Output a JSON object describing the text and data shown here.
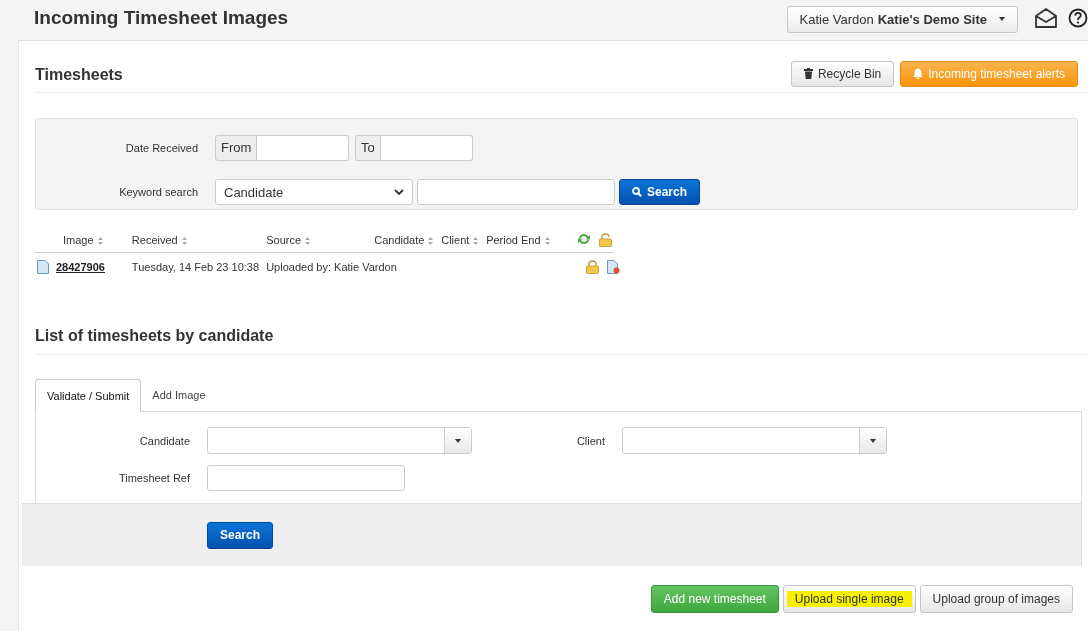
{
  "header": {
    "title": "Incoming Timesheet Images",
    "user_name": "Katie Vardon",
    "site_name": "Katie's Demo Site"
  },
  "timesheets": {
    "title": "Timesheets",
    "buttons": [
      {
        "label": "Recycle Bin",
        "kind": "default"
      },
      {
        "label": "Incoming timesheet alerts",
        "kind": "warning"
      }
    ],
    "filters": {
      "date_label": "Date Received",
      "from_label": "From",
      "to_label": "To",
      "keyword_label": "Keyword search",
      "keyword_select": "Candidate",
      "search_button": "Search"
    },
    "table": {
      "columns": [
        "Image",
        "Received",
        "Source",
        "Candidate",
        "Client",
        "Period End"
      ],
      "rows": [
        {
          "image": "28427906",
          "received": "Tuesday, 14 Feb 23 10:38",
          "source": "Uploaded by: Katie Vardon"
        }
      ]
    }
  },
  "candidate_list": {
    "title": "List of timesheets by candidate",
    "tabs": [
      {
        "label": "Validate / Submit",
        "selected": true
      },
      {
        "label": "Add Image",
        "selected": false
      }
    ],
    "candidate_label": "Candidate",
    "client_label": "Client",
    "ref_label": "Timesheet Ref",
    "search_button": "Search"
  },
  "footer_buttons": [
    {
      "label": "Add new timesheet",
      "kind": "success",
      "highlighted": false
    },
    {
      "label": "Upload single image",
      "kind": "default",
      "highlighted": true
    },
    {
      "label": "Upload group of images",
      "kind": "default",
      "highlighted": false
    }
  ]
}
